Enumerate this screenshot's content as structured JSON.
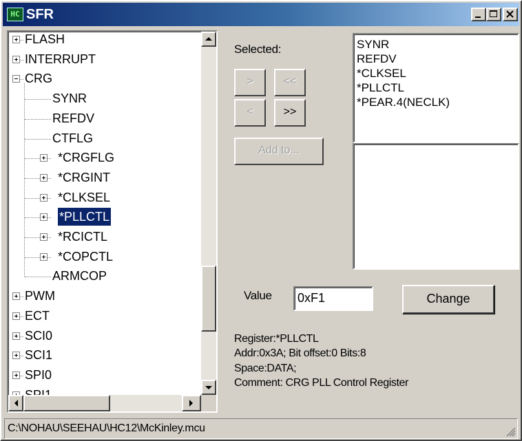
{
  "window": {
    "title": "SFR",
    "app_icon": "mcu-chip-icon"
  },
  "tree": {
    "items": [
      {
        "label": "FLASH",
        "level": 0,
        "expander": "plus"
      },
      {
        "label": "INTERRUPT",
        "level": 0,
        "expander": "plus"
      },
      {
        "label": "CRG",
        "level": 0,
        "expander": "minus"
      },
      {
        "label": "SYNR",
        "level": 1,
        "expander": "none"
      },
      {
        "label": "REFDV",
        "level": 1,
        "expander": "none"
      },
      {
        "label": "CTFLG",
        "level": 1,
        "expander": "none"
      },
      {
        "label": "*CRGFLG",
        "level": 1,
        "expander": "plus"
      },
      {
        "label": "*CRGINT",
        "level": 1,
        "expander": "plus"
      },
      {
        "label": "*CLKSEL",
        "level": 1,
        "expander": "plus"
      },
      {
        "label": "*PLLCTL",
        "level": 1,
        "expander": "plus",
        "selected": true
      },
      {
        "label": "*RCICTL",
        "level": 1,
        "expander": "plus"
      },
      {
        "label": "*COPCTL",
        "level": 1,
        "expander": "plus"
      },
      {
        "label": "ARMCOP",
        "level": 1,
        "expander": "none"
      },
      {
        "label": "PWM",
        "level": 0,
        "expander": "plus"
      },
      {
        "label": "ECT",
        "level": 0,
        "expander": "plus"
      },
      {
        "label": "SCI0",
        "level": 0,
        "expander": "plus"
      },
      {
        "label": "SCI1",
        "level": 0,
        "expander": "plus"
      },
      {
        "label": "SPI0",
        "level": 0,
        "expander": "plus"
      },
      {
        "label": "SPI1",
        "level": 0,
        "expander": "plus"
      }
    ]
  },
  "selection": {
    "label": "Selected:",
    "move_right": ">",
    "move_all_left": "<<",
    "move_left": "<",
    "move_all_right": ">>",
    "add_to": "Add to...",
    "selected_list": [
      "SYNR",
      "REFDV",
      "*CLKSEL",
      "*PLLCTL",
      "*PEAR.4(NECLK)"
    ]
  },
  "details": {
    "value_label": "Value",
    "value": "0xF1",
    "change_button": "Change",
    "register": "Register:*PLLCTL",
    "addr": "Addr:0x3A; Bit offset:0 Bits:8",
    "space": "Space:DATA;",
    "comment": "Comment: CRG PLL Control Register"
  },
  "status": {
    "path": "C:\\NOHAU\\SEEHAU\\HC12\\McKinley.mcu"
  }
}
